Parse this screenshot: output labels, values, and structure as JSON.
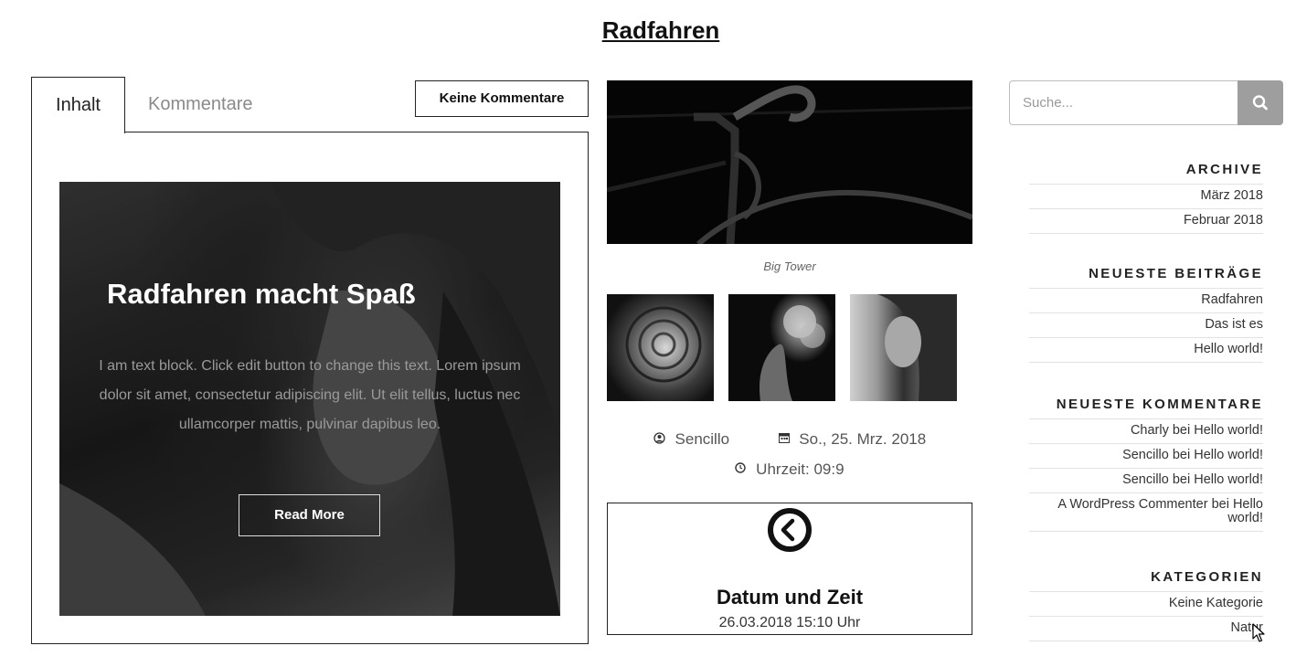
{
  "page_title": "Radfahren",
  "tabs": [
    {
      "label": "Inhalt",
      "active": true
    },
    {
      "label": "Kommentare",
      "active": false
    }
  ],
  "comments_button": "Keine Kommentare",
  "hero": {
    "title": "Radfahren macht Spaß",
    "text": "I am text block. Click edit button to change this text. Lorem ipsum dolor sit amet, consectetur adipiscing elit. Ut elit tellus, luctus nec ullamcorper mattis, pulvinar dapibus leo.",
    "button": "Read More"
  },
  "featured_image": {
    "caption": "Big Tower"
  },
  "gallery": [
    "rose",
    "smoke",
    "woman"
  ],
  "meta": {
    "author": "Sencillo",
    "date": "So., 25. Mrz. 2018",
    "time": "Uhrzeit: 09:9",
    "author_icon": "user-circle-icon",
    "date_icon": "calendar-icon",
    "time_icon": "clock-icon"
  },
  "datetime_widget": {
    "title": "Datum und Zeit",
    "value": "26.03.2018 15:10 Uhr",
    "icon": "back-arrow-circle-icon"
  },
  "search": {
    "placeholder": "Suche...",
    "icon": "search-icon"
  },
  "sidebar": {
    "archive": {
      "title": "ARCHIVE",
      "items": [
        "März 2018",
        "Februar 2018"
      ]
    },
    "recent_posts": {
      "title": "NEUESTE BEITRÄGE",
      "items": [
        "Radfahren",
        "Das ist es",
        "Hello world!"
      ]
    },
    "recent_comments": {
      "title": "NEUESTE KOMMENTARE",
      "items": [
        "Charly bei Hello world!",
        "Sencillo bei Hello world!",
        "Sencillo bei Hello world!",
        "A WordPress Commenter bei Hello world!"
      ]
    },
    "categories": {
      "title": "KATEGORIEN",
      "items": [
        "Keine Kategorie",
        "Natur"
      ]
    }
  },
  "colors": {
    "border": "#222222",
    "search_button": "#9e9e9e",
    "muted_text": "#8a8a8a"
  }
}
